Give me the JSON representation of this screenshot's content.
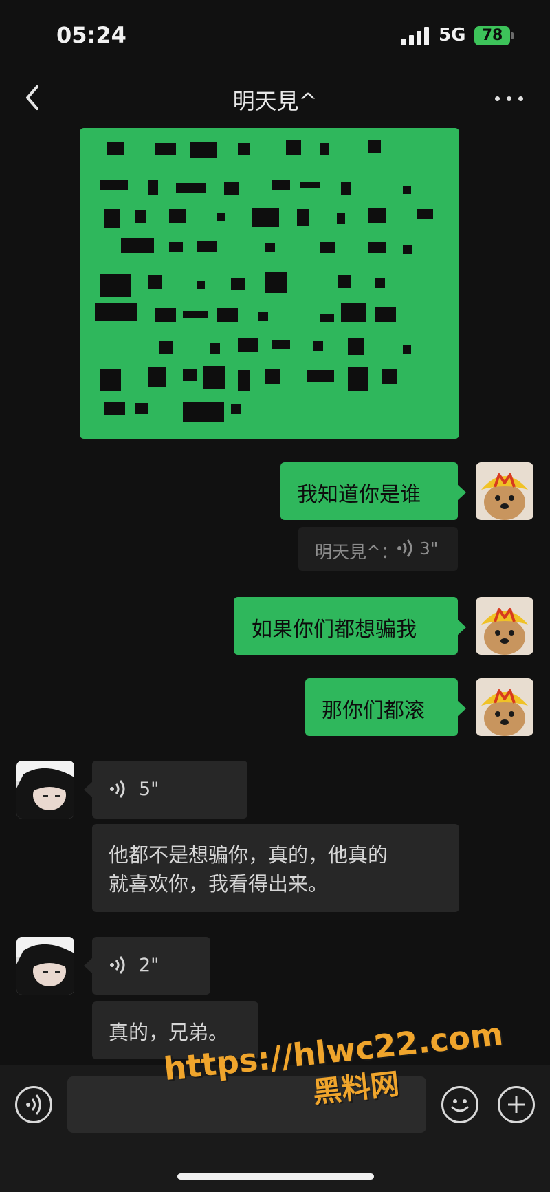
{
  "status_bar": {
    "time": "05:24",
    "network": "5G",
    "battery": "78"
  },
  "header": {
    "title": "明天見^"
  },
  "messages": [
    {
      "side": "right",
      "kind": "text",
      "text": "我知道你是谁"
    },
    {
      "side": "right",
      "kind": "quote",
      "author": "明天見^：",
      "duration": "3\""
    },
    {
      "side": "right",
      "kind": "text",
      "text": "如果你们都想骗我"
    },
    {
      "side": "right",
      "kind": "text",
      "text": "那你们都滚"
    },
    {
      "side": "left",
      "kind": "voice",
      "duration": "5\""
    },
    {
      "side": "left",
      "kind": "text",
      "line1": "他都不是想骗你，真的，他真的",
      "line2": "就喜欢你，我看得出来。"
    },
    {
      "side": "left",
      "kind": "voice",
      "duration": "2\""
    },
    {
      "side": "left",
      "kind": "text",
      "text": "真的，兄弟。"
    }
  ],
  "watermark": {
    "url": "https://hlwc22.com",
    "name": "黑料网"
  },
  "icons": [
    "chevron-left-icon",
    "more-icon",
    "voice-icon",
    "emoji-icon",
    "plus-icon"
  ],
  "colors": {
    "bubble_green": "#2fb75c",
    "bubble_dark": "#272727",
    "background": "#111111"
  }
}
